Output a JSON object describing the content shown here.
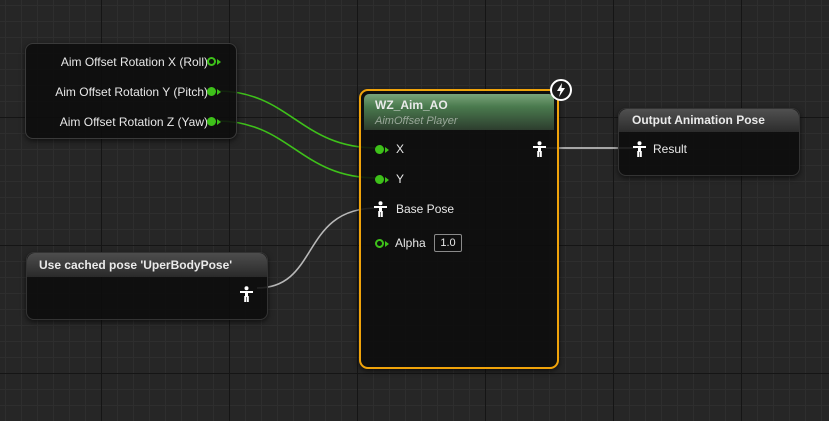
{
  "inputs_node": {
    "pins": [
      {
        "label": "Aim Offset Rotation X (Roll)"
      },
      {
        "label": "Aim Offset Rotation Y (Pitch)"
      },
      {
        "label": "Aim Offset Rotation Z (Yaw)"
      }
    ]
  },
  "aimoffset_node": {
    "title": "WZ_Aim_AO",
    "subtitle": "AimOffset Player",
    "pins": {
      "x": "X",
      "y": "Y",
      "base_pose": "Base Pose",
      "alpha": "Alpha",
      "alpha_value": "1.0"
    }
  },
  "cached_pose_node": {
    "title": "Use cached pose 'UperBodyPose'"
  },
  "output_node": {
    "title": "Output Animation Pose",
    "pin_label": "Result"
  },
  "colors": {
    "float_pin": "#3ec11a",
    "selection": "#f0a30a",
    "pose_wire": "#c8c8c8",
    "aimoffset_header": "#4a7a4e"
  },
  "icons": [
    "lightning-icon",
    "pose-pin-icon"
  ]
}
